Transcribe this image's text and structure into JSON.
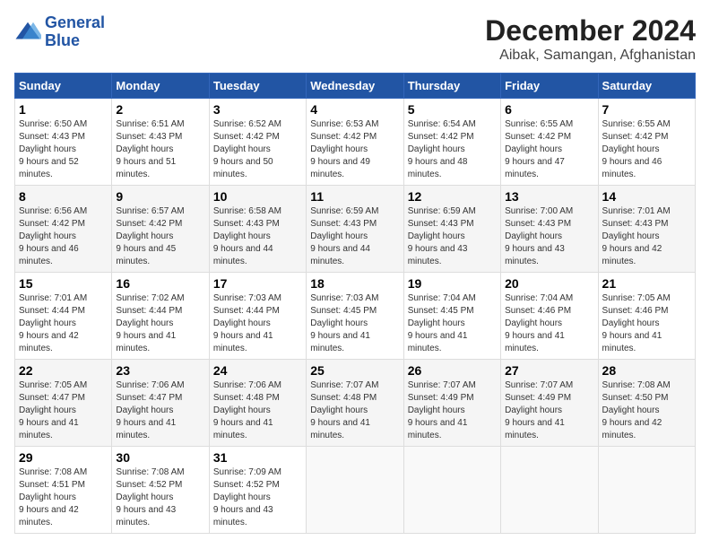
{
  "logo": {
    "line1": "General",
    "line2": "Blue"
  },
  "title": "December 2024",
  "subtitle": "Aibak, Samangan, Afghanistan",
  "days_of_week": [
    "Sunday",
    "Monday",
    "Tuesday",
    "Wednesday",
    "Thursday",
    "Friday",
    "Saturday"
  ],
  "weeks": [
    [
      {
        "day": 1,
        "sunrise": "6:50 AM",
        "sunset": "4:43 PM",
        "daylight": "9 hours and 52 minutes."
      },
      {
        "day": 2,
        "sunrise": "6:51 AM",
        "sunset": "4:43 PM",
        "daylight": "9 hours and 51 minutes."
      },
      {
        "day": 3,
        "sunrise": "6:52 AM",
        "sunset": "4:42 PM",
        "daylight": "9 hours and 50 minutes."
      },
      {
        "day": 4,
        "sunrise": "6:53 AM",
        "sunset": "4:42 PM",
        "daylight": "9 hours and 49 minutes."
      },
      {
        "day": 5,
        "sunrise": "6:54 AM",
        "sunset": "4:42 PM",
        "daylight": "9 hours and 48 minutes."
      },
      {
        "day": 6,
        "sunrise": "6:55 AM",
        "sunset": "4:42 PM",
        "daylight": "9 hours and 47 minutes."
      },
      {
        "day": 7,
        "sunrise": "6:55 AM",
        "sunset": "4:42 PM",
        "daylight": "9 hours and 46 minutes."
      }
    ],
    [
      {
        "day": 8,
        "sunrise": "6:56 AM",
        "sunset": "4:42 PM",
        "daylight": "9 hours and 46 minutes."
      },
      {
        "day": 9,
        "sunrise": "6:57 AM",
        "sunset": "4:42 PM",
        "daylight": "9 hours and 45 minutes."
      },
      {
        "day": 10,
        "sunrise": "6:58 AM",
        "sunset": "4:43 PM",
        "daylight": "9 hours and 44 minutes."
      },
      {
        "day": 11,
        "sunrise": "6:59 AM",
        "sunset": "4:43 PM",
        "daylight": "9 hours and 44 minutes."
      },
      {
        "day": 12,
        "sunrise": "6:59 AM",
        "sunset": "4:43 PM",
        "daylight": "9 hours and 43 minutes."
      },
      {
        "day": 13,
        "sunrise": "7:00 AM",
        "sunset": "4:43 PM",
        "daylight": "9 hours and 43 minutes."
      },
      {
        "day": 14,
        "sunrise": "7:01 AM",
        "sunset": "4:43 PM",
        "daylight": "9 hours and 42 minutes."
      }
    ],
    [
      {
        "day": 15,
        "sunrise": "7:01 AM",
        "sunset": "4:44 PM",
        "daylight": "9 hours and 42 minutes."
      },
      {
        "day": 16,
        "sunrise": "7:02 AM",
        "sunset": "4:44 PM",
        "daylight": "9 hours and 41 minutes."
      },
      {
        "day": 17,
        "sunrise": "7:03 AM",
        "sunset": "4:44 PM",
        "daylight": "9 hours and 41 minutes."
      },
      {
        "day": 18,
        "sunrise": "7:03 AM",
        "sunset": "4:45 PM",
        "daylight": "9 hours and 41 minutes."
      },
      {
        "day": 19,
        "sunrise": "7:04 AM",
        "sunset": "4:45 PM",
        "daylight": "9 hours and 41 minutes."
      },
      {
        "day": 20,
        "sunrise": "7:04 AM",
        "sunset": "4:46 PM",
        "daylight": "9 hours and 41 minutes."
      },
      {
        "day": 21,
        "sunrise": "7:05 AM",
        "sunset": "4:46 PM",
        "daylight": "9 hours and 41 minutes."
      }
    ],
    [
      {
        "day": 22,
        "sunrise": "7:05 AM",
        "sunset": "4:47 PM",
        "daylight": "9 hours and 41 minutes."
      },
      {
        "day": 23,
        "sunrise": "7:06 AM",
        "sunset": "4:47 PM",
        "daylight": "9 hours and 41 minutes."
      },
      {
        "day": 24,
        "sunrise": "7:06 AM",
        "sunset": "4:48 PM",
        "daylight": "9 hours and 41 minutes."
      },
      {
        "day": 25,
        "sunrise": "7:07 AM",
        "sunset": "4:48 PM",
        "daylight": "9 hours and 41 minutes."
      },
      {
        "day": 26,
        "sunrise": "7:07 AM",
        "sunset": "4:49 PM",
        "daylight": "9 hours and 41 minutes."
      },
      {
        "day": 27,
        "sunrise": "7:07 AM",
        "sunset": "4:49 PM",
        "daylight": "9 hours and 41 minutes."
      },
      {
        "day": 28,
        "sunrise": "7:08 AM",
        "sunset": "4:50 PM",
        "daylight": "9 hours and 42 minutes."
      }
    ],
    [
      {
        "day": 29,
        "sunrise": "7:08 AM",
        "sunset": "4:51 PM",
        "daylight": "9 hours and 42 minutes."
      },
      {
        "day": 30,
        "sunrise": "7:08 AM",
        "sunset": "4:52 PM",
        "daylight": "9 hours and 43 minutes."
      },
      {
        "day": 31,
        "sunrise": "7:09 AM",
        "sunset": "4:52 PM",
        "daylight": "9 hours and 43 minutes."
      },
      null,
      null,
      null,
      null
    ]
  ]
}
